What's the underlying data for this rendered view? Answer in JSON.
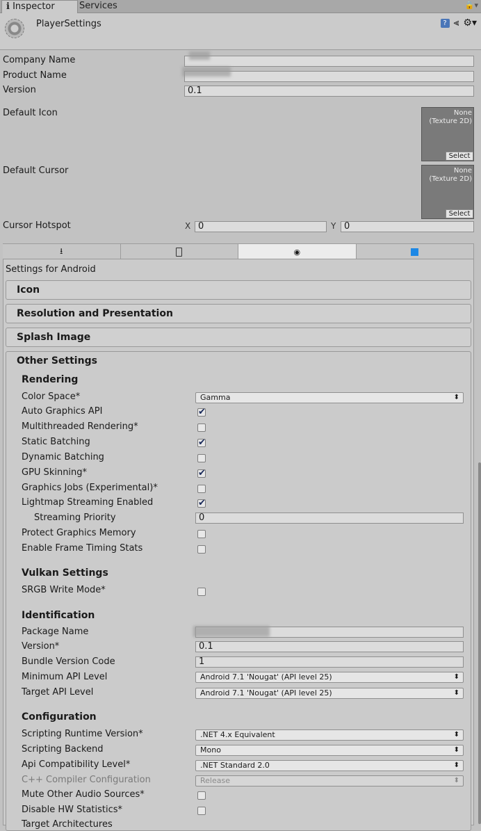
{
  "tabs": [
    {
      "label": "Inspector"
    },
    {
      "label": "Services"
    }
  ],
  "header": {
    "title": "PlayerSettings"
  },
  "general": {
    "company_name_label": "Company Name",
    "product_name_label": "Product Name",
    "version_label": "Version",
    "version_value": "0.1",
    "default_icon_label": "Default Icon",
    "default_cursor_label": "Default Cursor",
    "texture_none": "None",
    "texture_type": "(Texture 2D)",
    "select_label": "Select",
    "cursor_hotspot_label": "Cursor Hotspot",
    "hotspot_x_label": "X",
    "hotspot_x_value": "0",
    "hotspot_y_label": "Y",
    "hotspot_y_value": "0"
  },
  "platform": {
    "settings_for": "Settings for Android",
    "sections": [
      "Icon",
      "Resolution and Presentation",
      "Splash Image"
    ],
    "other_settings": "Other Settings"
  },
  "rendering": {
    "title": "Rendering",
    "color_space_label": "Color Space*",
    "color_space_value": "Gamma",
    "auto_graphics_api": "Auto Graphics API",
    "multithreaded_rendering": "Multithreaded Rendering*",
    "static_batching": "Static Batching",
    "dynamic_batching": "Dynamic Batching",
    "gpu_skinning": "GPU Skinning*",
    "graphics_jobs": "Graphics Jobs (Experimental)*",
    "lightmap_streaming": "Lightmap Streaming Enabled",
    "streaming_priority": "Streaming Priority",
    "streaming_priority_value": "0",
    "protect_graphics_memory": "Protect Graphics Memory",
    "enable_frame_timing": "Enable Frame Timing Stats"
  },
  "vulkan": {
    "title": "Vulkan Settings",
    "srgb_write_mode": "SRGB Write Mode*"
  },
  "identification": {
    "title": "Identification",
    "package_name": "Package Name",
    "version": "Version*",
    "version_value": "0.1",
    "bundle_version_code": "Bundle Version Code",
    "bundle_version_value": "1",
    "min_api": "Minimum API Level",
    "min_api_value": "Android 7.1 'Nougat' (API level 25)",
    "target_api": "Target API Level",
    "target_api_value": "Android 7.1 'Nougat' (API level 25)"
  },
  "configuration": {
    "title": "Configuration",
    "scripting_runtime": "Scripting Runtime Version*",
    "scripting_runtime_value": ".NET 4.x Equivalent",
    "scripting_backend": "Scripting Backend",
    "scripting_backend_value": "Mono",
    "api_compat": "Api Compatibility Level*",
    "api_compat_value": ".NET Standard 2.0",
    "cpp_compiler": "C++ Compiler Configuration",
    "cpp_compiler_value": "Release",
    "mute_audio": "Mute Other Audio Sources*",
    "disable_hw_stats": "Disable HW Statistics*",
    "target_architectures": "Target Architectures"
  },
  "icons": {
    "info": "info-icon",
    "help": "help-icon",
    "preset": "preset-icon",
    "settings": "gear-icon",
    "standalone": "download-icon",
    "ios": "phone-icon",
    "android": "android-icon",
    "windows": "windows-icon",
    "checkmark": "✔",
    "dropdown_arrow": "⬍"
  },
  "colors": {
    "panel": "#cbcbcb",
    "active_tab": "#ececec",
    "field": "#dcdcdc",
    "help_blue": "#4a76b8",
    "windows_blue": "#1e88e5"
  }
}
